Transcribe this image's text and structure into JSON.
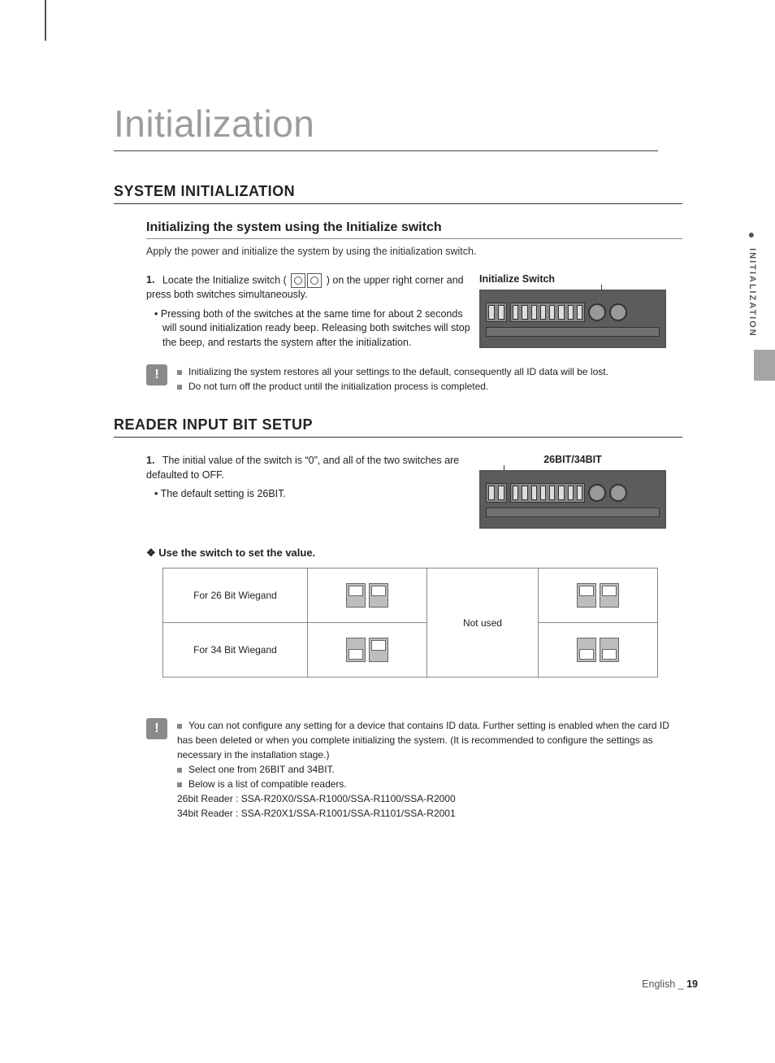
{
  "title": "Initialization",
  "sideTab": "INITIALIZATION",
  "section1": {
    "heading": "SYSTEM INITIALIZATION",
    "sub": "Initializing the system using the Initialize switch",
    "intro": "Apply the power and initialize the system by using the initialization switch.",
    "step1_a": "Locate the Initialize switch (",
    "step1_b": ") on the upper right corner and press both switches simultaneously.",
    "bullet1": "Pressing both of the switches at the same time for about 2 seconds will sound initialization ready beep. Releasing both switches will stop the beep, and restarts the system after the initialization.",
    "figLabel": "Initialize Switch",
    "notes": [
      "Initializing the system restores all your settings to the default, consequently all ID data will be lost.",
      "Do not turn off the product until the initialization process is completed."
    ]
  },
  "section2": {
    "heading": "READER INPUT BIT SETUP",
    "step1": "The initial value of the switch is “0”, and all of the two switches are defaulted to OFF.",
    "bullet1": "The default setting is 26BIT.",
    "figLabel": "26BIT/34BIT",
    "diamond": "Use the switch to set the value.",
    "table": {
      "r1c1": "For 26 Bit Wiegand",
      "r2c1": "For 34 Bit Wiegand",
      "mid": "Not used"
    },
    "notes": [
      "You can not configure any setting for a device that contains ID data. Further setting is enabled when the card ID has been deleted or when you complete initializing the system. (It is recommended to configure the settings as necessary in the installation stage.)",
      "Select one from 26BIT and 34BIT.",
      "Below is a list of compatible readers.\n26bit Reader : SSA-R20X0/SSA-R1000/SSA-R1100/SSA-R2000\n34bit Reader : SSA-R20X1/SSA-R1001/SSA-R1101/SSA-R2001"
    ]
  },
  "footer": {
    "lang": "English",
    "sep": "_",
    "page": "19"
  }
}
